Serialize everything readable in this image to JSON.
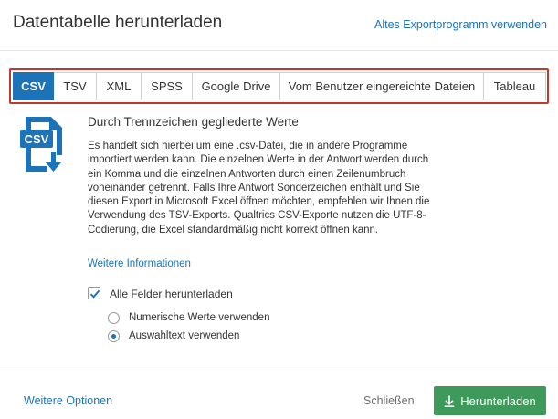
{
  "header": {
    "title": "Datentabelle herunterladen",
    "legacy_link": "Altes Exportprogramm verwenden"
  },
  "tabs": [
    {
      "label": "CSV",
      "active": true
    },
    {
      "label": "TSV",
      "active": false
    },
    {
      "label": "XML",
      "active": false
    },
    {
      "label": "SPSS",
      "active": false
    },
    {
      "label": "Google Drive",
      "active": false
    },
    {
      "label": "Vom Benutzer eingereichte Dateien",
      "active": false
    },
    {
      "label": "Tableau",
      "active": false
    }
  ],
  "content": {
    "file_icon": {
      "name": "csv-file-download-icon",
      "label": "CSV"
    },
    "heading": "Durch Trennzeichen gegliederte Werte",
    "description": "Es handelt sich hierbei um eine .csv-Datei, die in andere Programme importiert werden kann. Die einzelnen Werte in der Antwort werden durch ein Komma und die einzelnen Antworten durch einen Zeilenumbruch voneinander getrennt. Falls Ihre Antwort Sonderzeichen enthält und Sie diesen Export in Microsoft Excel öffnen möchten, empfehlen wir Ihnen die Verwendung des TSV-Exports. Qualtrics CSV-Exporte nutzen die UTF-8-Codierung, die Excel standardmäßig nicht korrekt öffnen kann.",
    "more_info_link": "Weitere Informationen"
  },
  "options": {
    "download_all_fields": {
      "label": "Alle Felder herunterladen",
      "checked": true
    },
    "radios": [
      {
        "label": "Numerische Werte verwenden",
        "checked": false
      },
      {
        "label": "Auswahltext verwenden",
        "checked": true
      }
    ]
  },
  "footer": {
    "more_options": "Weitere Optionen",
    "close": "Schließen",
    "download": "Herunterladen",
    "download_icon": "download-arrow-icon"
  },
  "colors": {
    "accent": "#1d73b8",
    "highlight_outline": "#c0392b",
    "download_button": "#3d9a5a"
  }
}
